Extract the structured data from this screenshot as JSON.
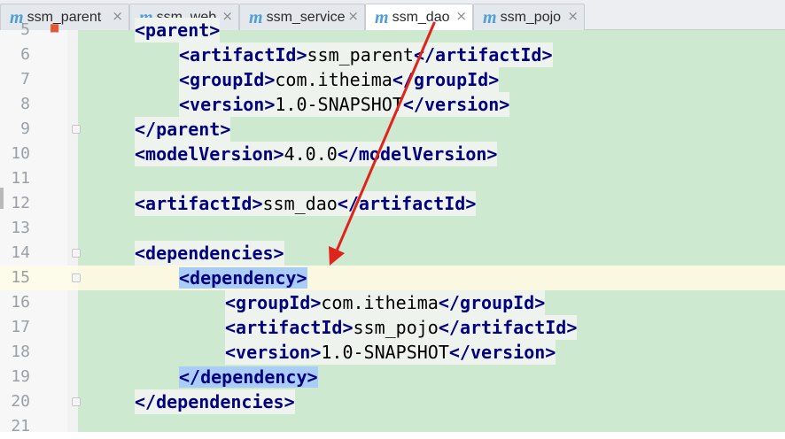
{
  "tabs": [
    {
      "label": "ssm_parent",
      "active": false
    },
    {
      "label": "ssm_web",
      "active": false
    },
    {
      "label": "ssm_service",
      "active": false
    },
    {
      "label": "ssm_dao",
      "active": true
    },
    {
      "label": "ssm_pojo",
      "active": false
    }
  ],
  "tab_icon_glyph": "m",
  "close_glyph": "×",
  "lines": [
    {
      "num": "5",
      "open": "<",
      "tag": "parent",
      "close": ">",
      "text": ""
    },
    {
      "num": "6",
      "pre": "<",
      "tag": "artifactId",
      "mid": ">",
      "text": "ssm_parent",
      "post": "</",
      "tag2": "artifactId",
      "end": ">"
    },
    {
      "num": "7",
      "pre": "<",
      "tag": "groupId",
      "mid": ">",
      "text": "com.itheima",
      "post": "</",
      "tag2": "groupId",
      "end": ">"
    },
    {
      "num": "8",
      "pre": "<",
      "tag": "version",
      "mid": ">",
      "text": "1.0-SNAPSHOT",
      "post": "</",
      "tag2": "version",
      "end": ">"
    },
    {
      "num": "9",
      "open": "</",
      "tag": "parent",
      "close": ">"
    },
    {
      "num": "10",
      "pre": "<",
      "tag": "modelVersion",
      "mid": ">",
      "text": "4.0.0",
      "post": "</",
      "tag2": "modelVersion",
      "end": ">"
    },
    {
      "num": "11"
    },
    {
      "num": "12",
      "pre": "<",
      "tag": "artifactId",
      "mid": ">",
      "text": "ssm_dao",
      "post": "</",
      "tag2": "artifactId",
      "end": ">"
    },
    {
      "num": "13"
    },
    {
      "num": "14",
      "open": "<",
      "tag": "dependencies",
      "close": ">"
    },
    {
      "num": "15",
      "open": "<",
      "tag": "dependency",
      "close": ">"
    },
    {
      "num": "16",
      "pre": "<",
      "tag": "groupId",
      "mid": ">",
      "text": "com.itheima",
      "post": "</",
      "tag2": "groupId",
      "end": ">"
    },
    {
      "num": "17",
      "pre": "<",
      "tag": "artifactId",
      "mid": ">",
      "text": "ssm_pojo",
      "post": "</",
      "tag2": "artifactId",
      "end": ">"
    },
    {
      "num": "18",
      "pre": "<",
      "tag": "version",
      "mid": ">",
      "text": "1.0-SNAPSHOT",
      "post": "</",
      "tag2": "version",
      "end": ">"
    },
    {
      "num": "19",
      "open": "</",
      "tag": "dependency",
      "close": ">"
    },
    {
      "num": "20",
      "open": "</",
      "tag": "dependencies",
      "close": ">"
    },
    {
      "num": "21"
    }
  ],
  "colors": {
    "tag": "#000080",
    "code_background": "#cde9cf",
    "selection": "#a9cdf7",
    "current_line": "#fbf8e2",
    "annotation_arrow": "#e0241c",
    "tab_icon": "#4e9ed8"
  }
}
